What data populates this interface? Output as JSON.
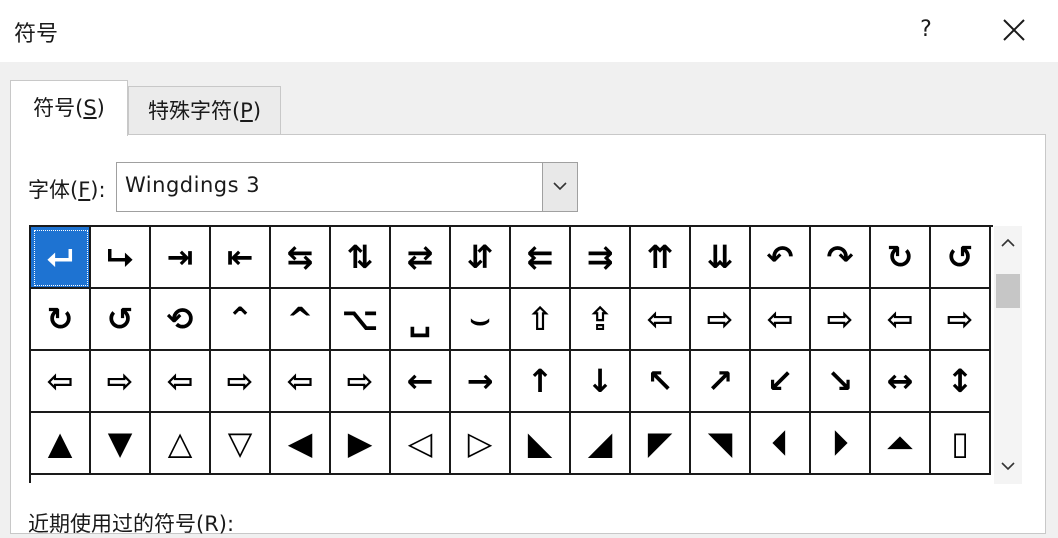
{
  "dialog": {
    "title": "符号",
    "help_label": "?",
    "close_icon": "close-icon"
  },
  "tabs": [
    {
      "label_prefix": "符号(",
      "accel": "S",
      "label_suffix": ")",
      "active": true
    },
    {
      "label_prefix": "特殊字符(",
      "accel": "P",
      "label_suffix": ")",
      "active": false
    }
  ],
  "font": {
    "label_prefix": "字体(",
    "accel": "F",
    "label_suffix": "):",
    "value": "Wingdings 3"
  },
  "symbols": [
    [
      "⮠",
      "⮡",
      "⇥",
      "⇤",
      "⇆",
      "⇅",
      "⇄",
      "⇵",
      "⇇",
      "⇉",
      "⇈",
      "⇊",
      "↶",
      "↷",
      "↻",
      "↺"
    ],
    [
      "↻",
      "↺",
      "⟲",
      "⌃",
      "^",
      "⌥",
      "␣",
      "⌣",
      "⇧",
      "⇪",
      "⇦",
      "⇨",
      "⇦",
      "⇨",
      "⇦",
      "⇨"
    ],
    [
      "⇦",
      "⇨",
      "⇦",
      "⇨",
      "⇦",
      "⇨",
      "←",
      "→",
      "↑",
      "↓",
      "↖",
      "↗",
      "↙",
      "↘",
      "↔",
      "↕"
    ],
    [
      "▲",
      "▼",
      "△",
      "▽",
      "◀",
      "▶",
      "◁",
      "▷",
      "◣",
      "◢",
      "◤",
      "◥",
      "⏴",
      "⏵",
      "⏶",
      "▯"
    ]
  ],
  "selected": {
    "row": 0,
    "col": 0
  },
  "scroll": {
    "position_percent": 10
  },
  "recent": {
    "label": "近期使用过的符号(R):"
  },
  "colors": {
    "selection": "#1e73d2",
    "grid_line": "#1a1a1a",
    "background": "#f0f0f0"
  }
}
